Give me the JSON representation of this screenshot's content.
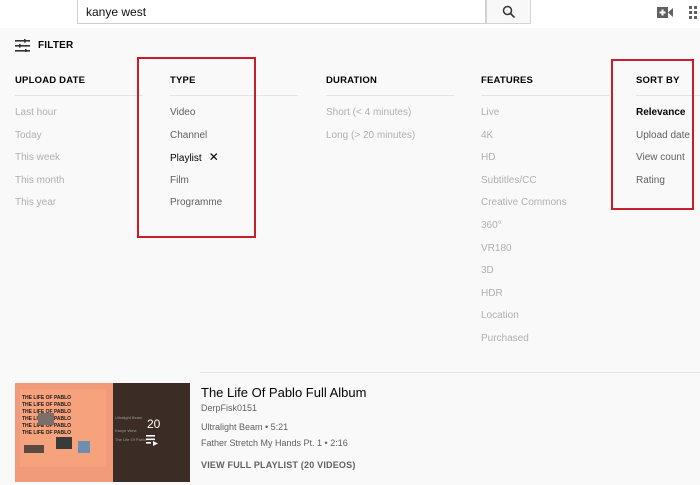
{
  "search": {
    "query": "kanye west"
  },
  "filter_label": "FILTER",
  "columns": [
    {
      "title": "UPLOAD DATE",
      "options": [
        "Last hour",
        "Today",
        "This week",
        "This month",
        "This year"
      ]
    },
    {
      "title": "TYPE",
      "options": [
        "Video",
        "Channel",
        "Playlist",
        "Film",
        "Programme"
      ],
      "selected": "Playlist",
      "remove_glyph": "✕"
    },
    {
      "title": "DURATION",
      "options": [
        "Short (< 4 minutes)",
        "Long (> 20 minutes)"
      ]
    },
    {
      "title": "FEATURES",
      "options": [
        "Live",
        "4K",
        "HD",
        "Subtitles/CC",
        "Creative Commons",
        "360°",
        "VR180",
        "3D",
        "HDR",
        "Location",
        "Purchased"
      ]
    },
    {
      "title": "SORT BY",
      "options": [
        "Relevance",
        "Upload date",
        "View count",
        "Rating"
      ],
      "selected": "Relevance"
    }
  ],
  "result": {
    "title": "The Life Of Pablo Full Album",
    "channel": "DerpFisk0151",
    "video_count_badge": "20",
    "tracks": [
      "Ultralight Beam • 5:21",
      "Father Stretch My Hands Pt. 1 • 2:16"
    ],
    "view_full": "VIEW FULL PLAYLIST (20 VIDEOS)",
    "thumbnail_text": {
      "line1": "THE LIFE OF      PABLO",
      "line2": "THE LIFE OF      PABLO",
      "line3": "THE LIFE OF      PABLO",
      "line4": "THE LIFE OF      PABLO",
      "line5": "THE LIFE OF      PABLO",
      "line6": "THE LIFE OF      PABLO",
      "overlay1": "Ultralight Beam",
      "overlay2": "Kanye West",
      "overlay3": "The Life Of Pablo"
    }
  },
  "colors": {
    "accent_red": "#c81e2b",
    "text": "#030303",
    "muted": "#b0b0b0",
    "secondary": "#606060"
  },
  "icons": [
    "search-icon",
    "video-camera-icon",
    "apps-grid-icon",
    "filter-sliders-icon",
    "close-icon",
    "playlist-icon"
  ]
}
